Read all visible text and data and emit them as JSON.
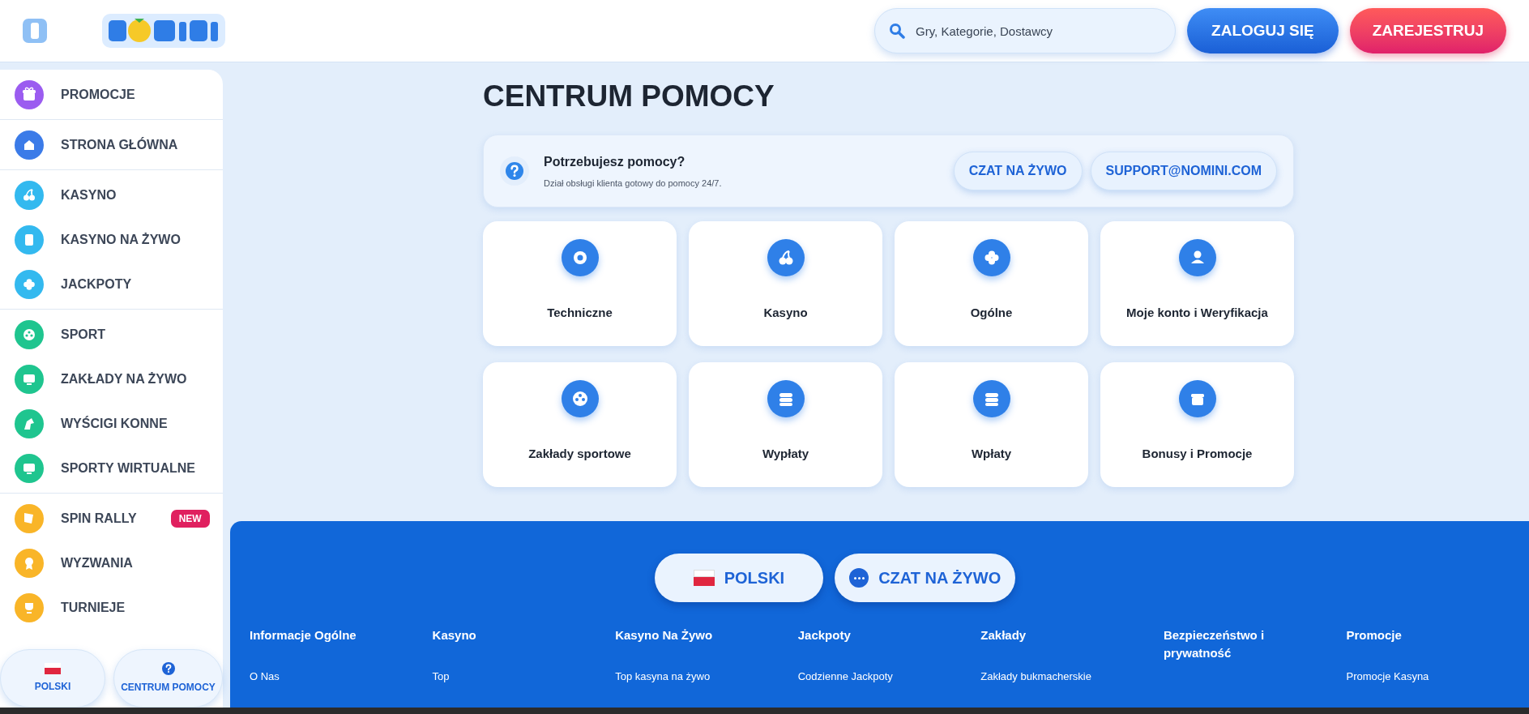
{
  "header": {
    "search": {
      "placeholder": "Gry, Kategorie, Dostawcy"
    },
    "login_button": "ZALOGUJ SIĘ",
    "register_button": "ZAREJESTRUJ"
  },
  "sidebar": {
    "groups": [
      {
        "items": [
          {
            "label": "PROMOCJE",
            "color": "#9b5cf0"
          }
        ]
      },
      {
        "items": [
          {
            "label": "STRONA GŁÓWNA",
            "color": "#3b7be8"
          }
        ]
      },
      {
        "items": [
          {
            "label": "KASYNO",
            "color": "#33b9ef"
          },
          {
            "label": "KASYNO NA ŻYWO",
            "color": "#33b9ef"
          },
          {
            "label": "JACKPOTY",
            "color": "#33b9ef"
          }
        ]
      },
      {
        "items": [
          {
            "label": "SPORT",
            "color": "#1fc58f"
          },
          {
            "label": "ZAKŁADY NA ŻYWO",
            "color": "#1fc58f"
          },
          {
            "label": "WYŚCIGI KONNE",
            "color": "#1fc58f"
          },
          {
            "label": "SPORTY WIRTUALNE",
            "color": "#1fc58f"
          }
        ]
      },
      {
        "items": [
          {
            "label": "SPIN RALLY",
            "color": "#f9b528",
            "badge": "NEW"
          },
          {
            "label": "WYZWANIA",
            "color": "#f9b528"
          },
          {
            "label": "TURNIEJE",
            "color": "#f9b528"
          }
        ]
      }
    ],
    "bottom_buttons": [
      "POLSKI",
      "CENTRUM POMOCY"
    ]
  },
  "page_title": "CENTRUM POMOCY",
  "help_box": {
    "title": "Potrzebujesz pomocy?",
    "subtitle": "Dział obsługi klienta gotowy do pomocy 24/7.",
    "buttons": [
      "CZAT NA ŻYWO",
      "SUPPORT@NOMINI.COM"
    ]
  },
  "categories": [
    "Techniczne",
    "Kasyno",
    "Ogólne",
    "Moje konto i Weryfikacja",
    "Zakłady sportowe",
    "Wypłaty",
    "Wpłaty",
    "Bonusy i Promocje"
  ],
  "footer": {
    "buttons": [
      "POLSKI",
      "CZAT NA ŻYWO"
    ],
    "columns": [
      {
        "heading": "Informacje Ogólne",
        "links": [
          "O Nas"
        ]
      },
      {
        "heading": "Kasyno",
        "links": [
          "Top"
        ]
      },
      {
        "heading": "Kasyno Na Żywo",
        "links": [
          "Top kasyna na żywo"
        ]
      },
      {
        "heading": "Jackpoty",
        "links": [
          "Codzienne Jackpoty"
        ]
      },
      {
        "heading": "Zakłady",
        "links": [
          "Zakłady bukmacherskie"
        ]
      },
      {
        "heading": "Bezpieczeństwo i prywatność"
      },
      {
        "heading": "Promocje",
        "links": [
          "Promocje Kasyna"
        ]
      }
    ]
  }
}
